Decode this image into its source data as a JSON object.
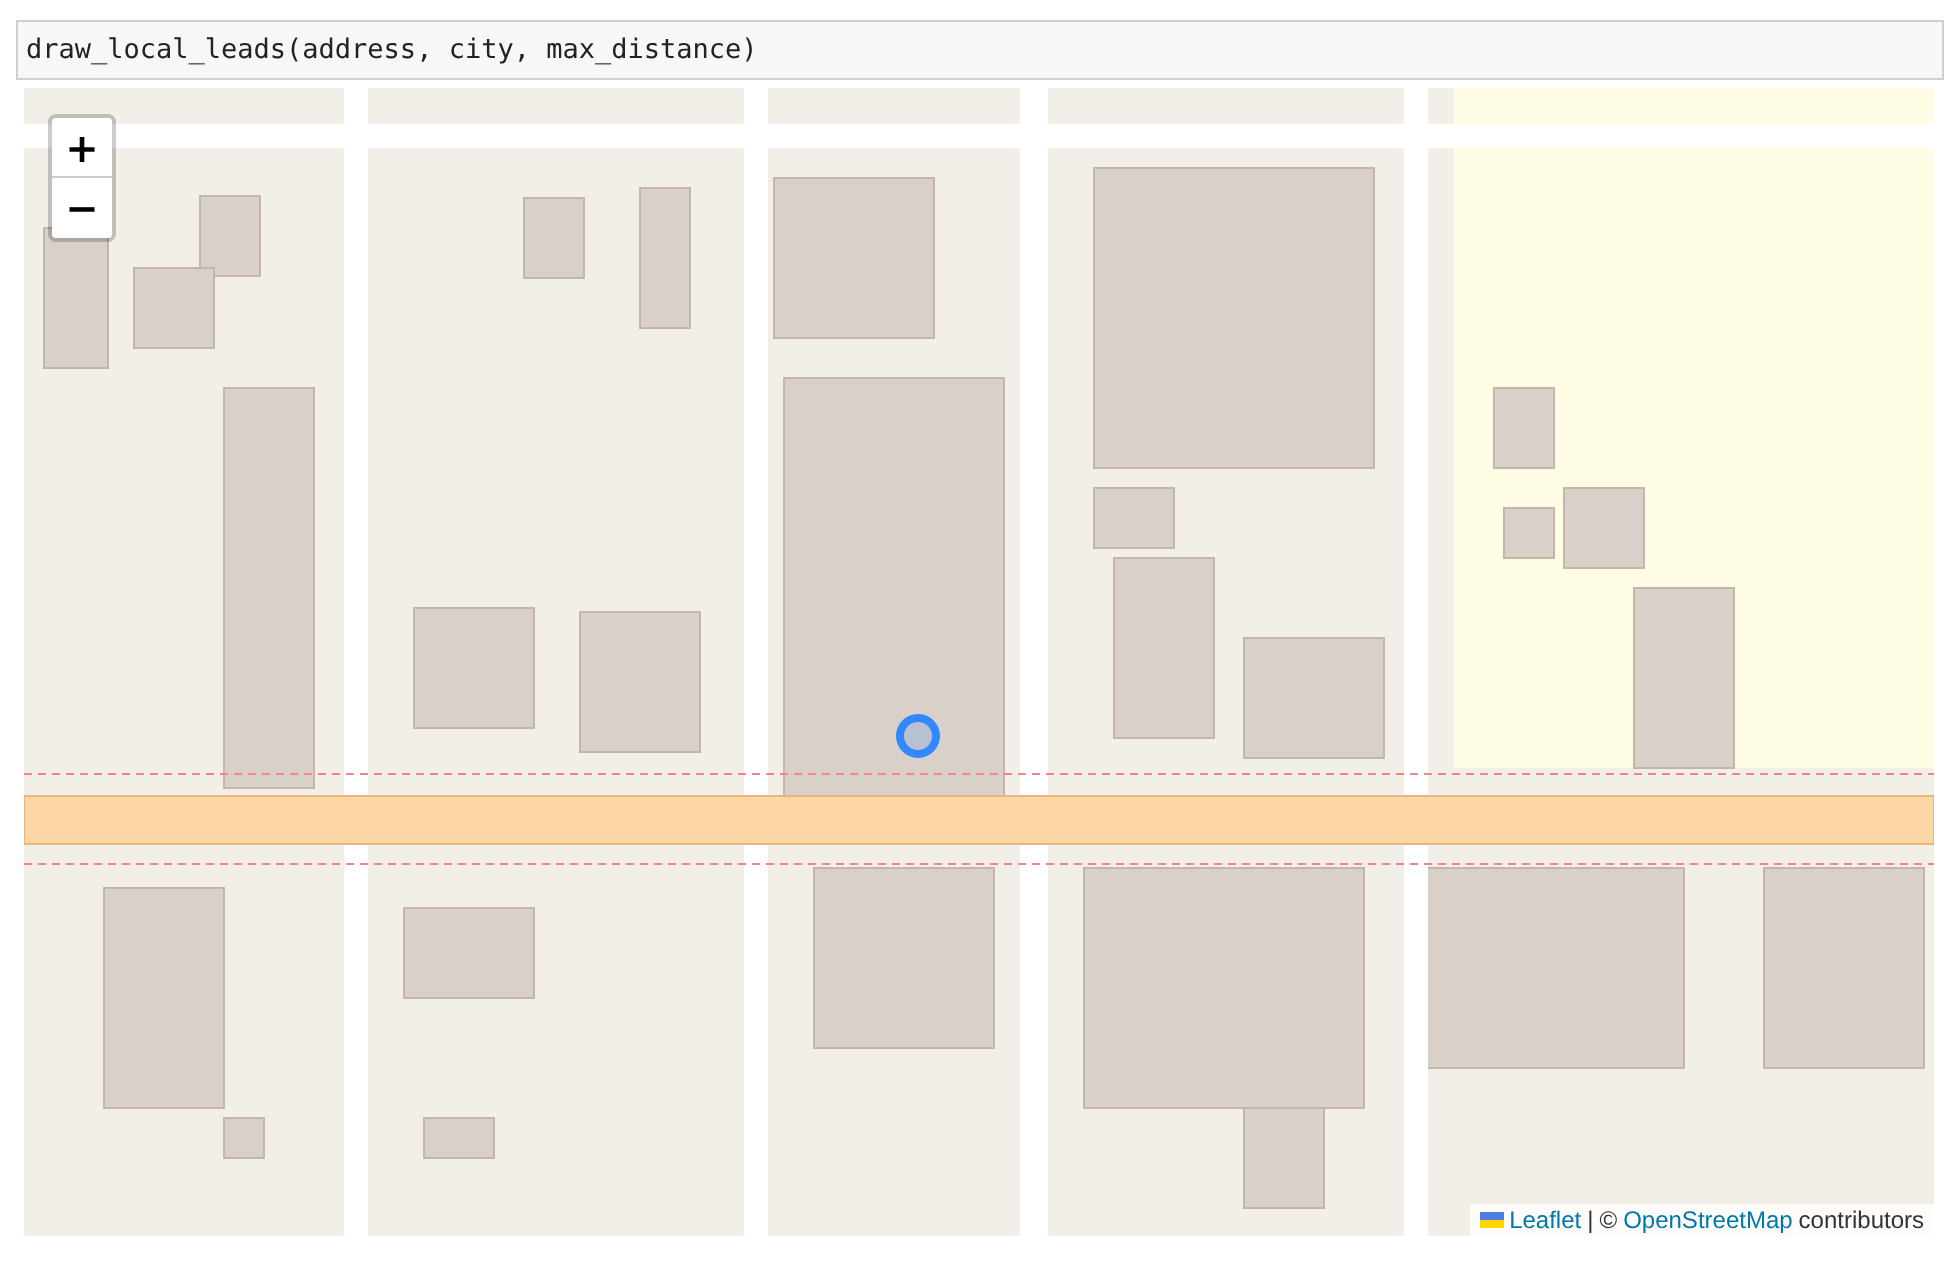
{
  "code_cell": {
    "code": "draw_local_leads(address, city, max_distance)"
  },
  "map": {
    "zoom_in": "+",
    "zoom_out": "−",
    "attribution": {
      "leaflet_link": "Leaflet",
      "separator": "|",
      "copyright": "©",
      "osm_link": "OpenStreetMap",
      "suffix": "contributors"
    }
  }
}
